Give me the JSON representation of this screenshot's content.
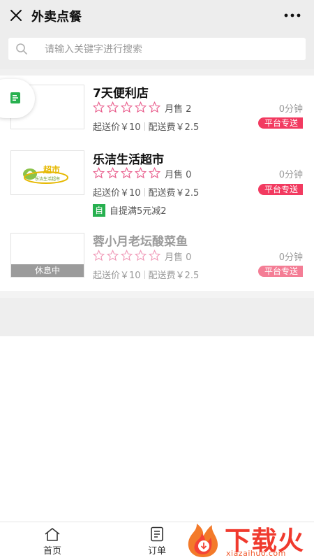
{
  "header": {
    "title": "外卖点餐"
  },
  "search": {
    "placeholder": "请输入关键字进行搜索"
  },
  "stores": [
    {
      "name": "7天便利店",
      "rating": 0,
      "monthly_sales": "月售 2",
      "eta": "0分钟",
      "min_order": "起送价￥10",
      "delivery_fee": "配送费￥2.5",
      "delivery_badge": "平台专送"
    },
    {
      "name": "乐洁生活超市",
      "rating": 0,
      "monthly_sales": "月售 0",
      "eta": "0分钟",
      "min_order": "起送价￥10",
      "delivery_fee": "配送费￥2.5",
      "delivery_badge": "平台专送",
      "logo_text": "超市",
      "logo_subtext": "乐洁生活超市",
      "promo_tag": "自",
      "promo_text": "自提满5元减2"
    },
    {
      "name": "蓉小月老坛酸菜鱼",
      "rating": 0,
      "monthly_sales": "月售 0",
      "eta": "0分钟",
      "min_order": "起送价￥10",
      "delivery_fee": "配送费￥2.5",
      "delivery_badge": "平台专送",
      "status": "休息中"
    }
  ],
  "tabbar": {
    "home_label": "首页",
    "orders_label": "订单"
  },
  "watermark": {
    "text": "下载火",
    "subtext": "xiazaihuo.com"
  },
  "colors": {
    "badge": "#f23a60",
    "star": "#e85a8a",
    "promo": "#27b04f",
    "accent": "#f03a2e"
  }
}
